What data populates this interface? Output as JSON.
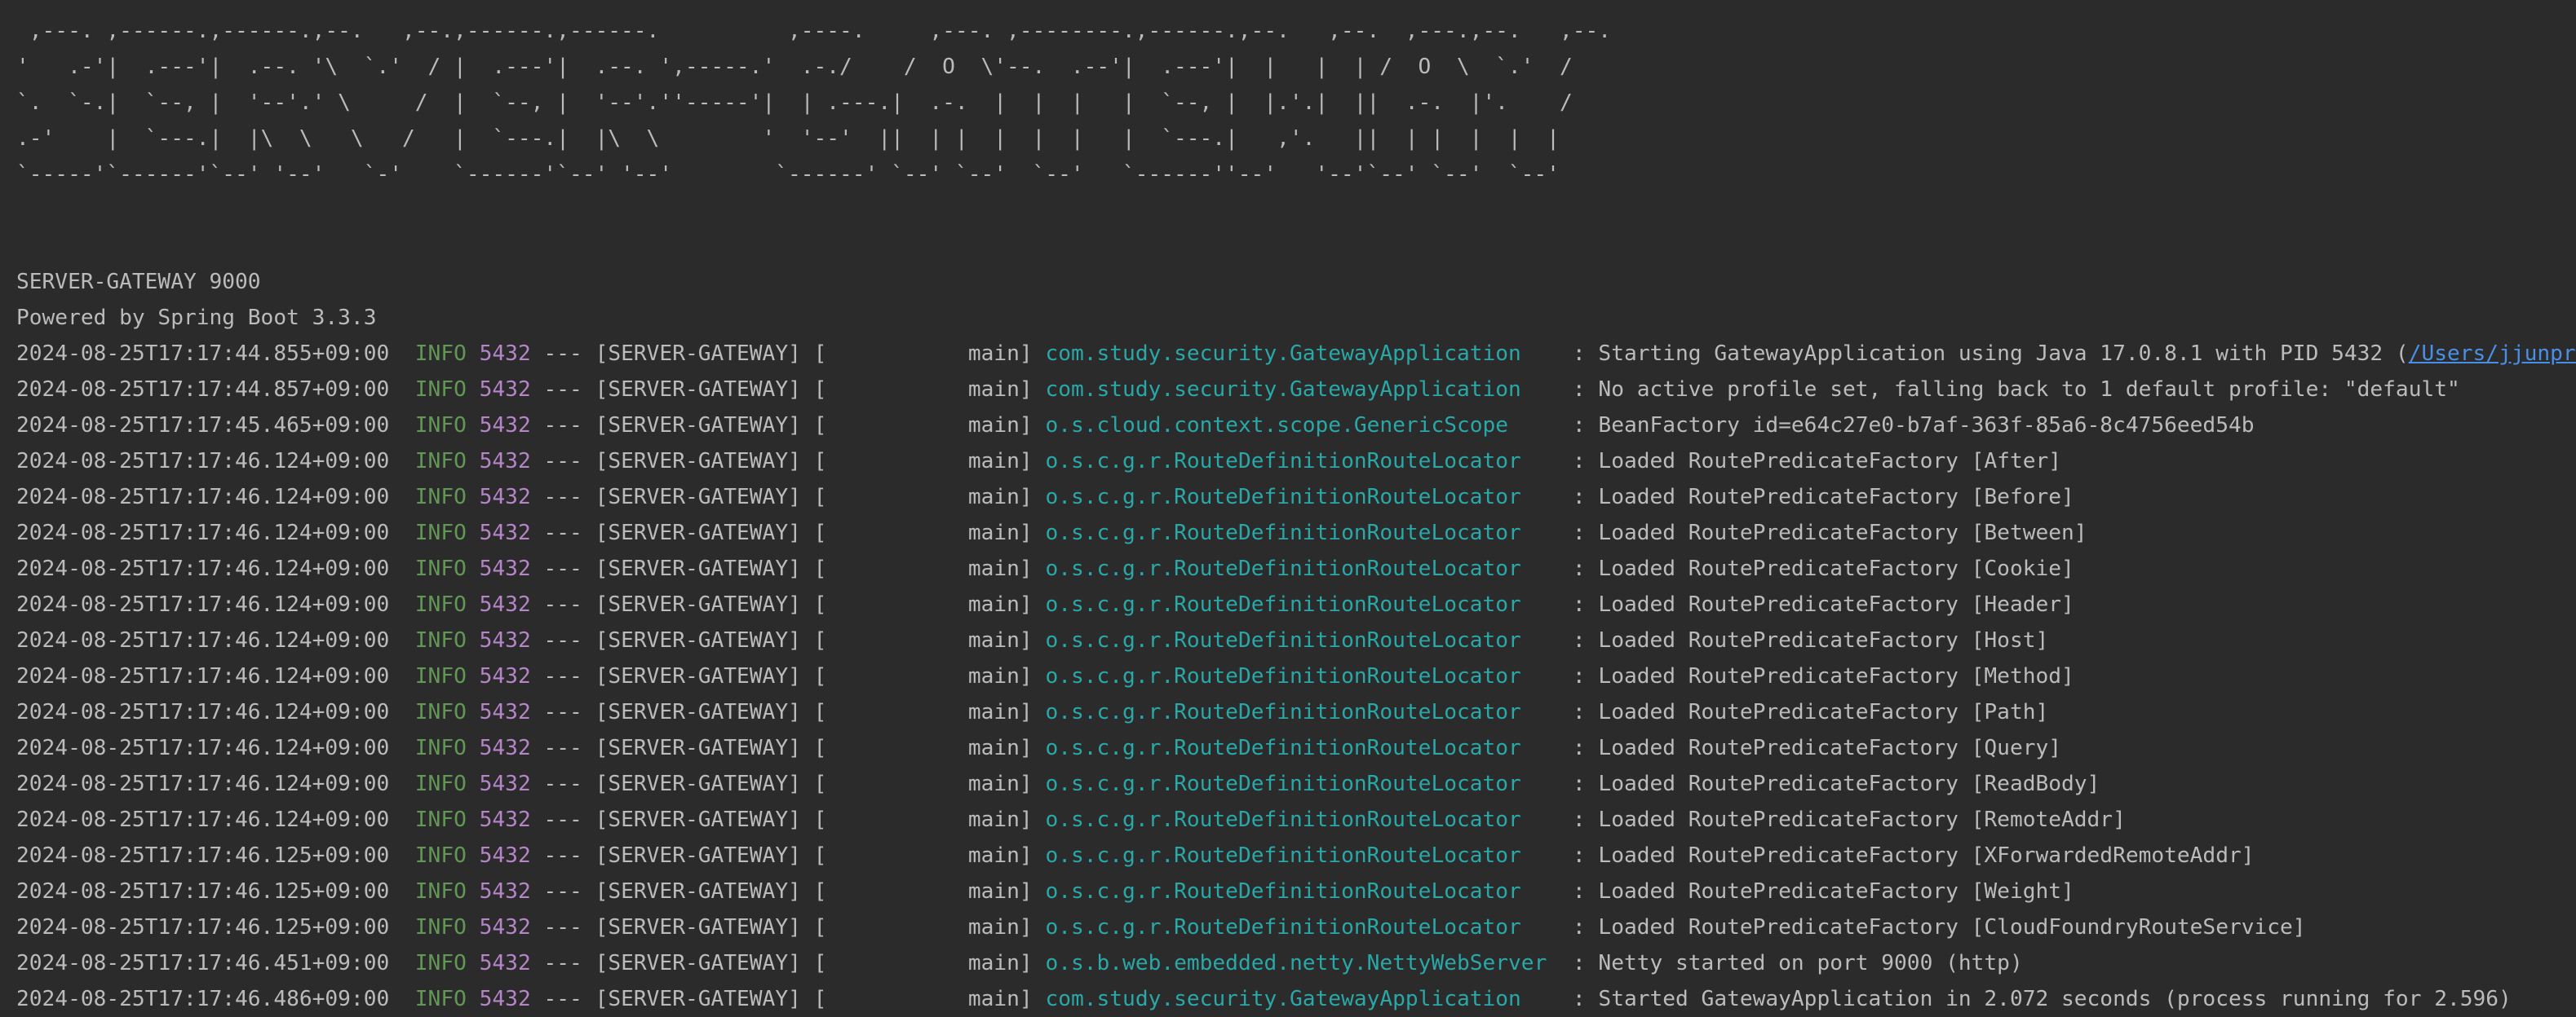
{
  "banner": [
    " ,---. ,------.,------.,--.   ,--.,------.,------.          ,----.     ,---. ,--------.,------.,--.   ,--.  ,---.,--.   ,--.",
    "'   .-'|  .---'|  .--. '\\  `.'  / |  .---'|  .--. ',-----.'  .-./    /  O  \\'--.  .--'|  .---'|  |   |  | /  O  \\  `.'  /",
    "`.  `-.|  `--, |  '--'.' \\     /  |  `--, |  '--'.''-----'|  | .---.|  .-.  |  |  |   |  `--, |  |.'.|  ||  .-.  |'.    /",
    ".-'    |  `---.|  |\\  \\   \\   /   |  `---.|  |\\  \\        '  '--'  ||  | |  |  |  |   |  `---.|   ,'.   ||  | |  |  |  |",
    "`-----'`------'`--' '--'   `-'    `------'`--' '--'        `------' `--' `--'  `--'   `------''--'   '--'`--' `--'  `--'"
  ],
  "header": {
    "app_line": "SERVER-GATEWAY 9000",
    "powered_by": "Powered by Spring Boot 3.3.3"
  },
  "colors": {
    "background": "#2b2b2b",
    "text": "#bbbbbb",
    "info": "#629755",
    "pid": "#b585c8",
    "logger": "#2aa7a7",
    "link": "#4a8fe7"
  },
  "logs": [
    {
      "ts": "2024-08-25T17:17:44.855+09:00",
      "level": "INFO",
      "pid": "5432",
      "sep": "---",
      "app": "[SERVER-GATEWAY]",
      "thread": "[           main]",
      "logger": "com.study.security.GatewayApplication   ",
      "msg": ": Starting GatewayApplication using Java 17.0.8.1 with PID 5432 (",
      "link": "/Users/jjunpro/"
    },
    {
      "ts": "2024-08-25T17:17:44.857+09:00",
      "level": "INFO",
      "pid": "5432",
      "sep": "---",
      "app": "[SERVER-GATEWAY]",
      "thread": "[           main]",
      "logger": "com.study.security.GatewayApplication   ",
      "msg": ": No active profile set, falling back to 1 default profile: \"default\""
    },
    {
      "ts": "2024-08-25T17:17:45.465+09:00",
      "level": "INFO",
      "pid": "5432",
      "sep": "---",
      "app": "[SERVER-GATEWAY]",
      "thread": "[           main]",
      "logger": "o.s.cloud.context.scope.GenericScope    ",
      "msg": ": BeanFactory id=e64c27e0-b7af-363f-85a6-8c4756eed54b"
    },
    {
      "ts": "2024-08-25T17:17:46.124+09:00",
      "level": "INFO",
      "pid": "5432",
      "sep": "---",
      "app": "[SERVER-GATEWAY]",
      "thread": "[           main]",
      "logger": "o.s.c.g.r.RouteDefinitionRouteLocator   ",
      "msg": ": Loaded RoutePredicateFactory [After]"
    },
    {
      "ts": "2024-08-25T17:17:46.124+09:00",
      "level": "INFO",
      "pid": "5432",
      "sep": "---",
      "app": "[SERVER-GATEWAY]",
      "thread": "[           main]",
      "logger": "o.s.c.g.r.RouteDefinitionRouteLocator   ",
      "msg": ": Loaded RoutePredicateFactory [Before]"
    },
    {
      "ts": "2024-08-25T17:17:46.124+09:00",
      "level": "INFO",
      "pid": "5432",
      "sep": "---",
      "app": "[SERVER-GATEWAY]",
      "thread": "[           main]",
      "logger": "o.s.c.g.r.RouteDefinitionRouteLocator   ",
      "msg": ": Loaded RoutePredicateFactory [Between]"
    },
    {
      "ts": "2024-08-25T17:17:46.124+09:00",
      "level": "INFO",
      "pid": "5432",
      "sep": "---",
      "app": "[SERVER-GATEWAY]",
      "thread": "[           main]",
      "logger": "o.s.c.g.r.RouteDefinitionRouteLocator   ",
      "msg": ": Loaded RoutePredicateFactory [Cookie]"
    },
    {
      "ts": "2024-08-25T17:17:46.124+09:00",
      "level": "INFO",
      "pid": "5432",
      "sep": "---",
      "app": "[SERVER-GATEWAY]",
      "thread": "[           main]",
      "logger": "o.s.c.g.r.RouteDefinitionRouteLocator   ",
      "msg": ": Loaded RoutePredicateFactory [Header]"
    },
    {
      "ts": "2024-08-25T17:17:46.124+09:00",
      "level": "INFO",
      "pid": "5432",
      "sep": "---",
      "app": "[SERVER-GATEWAY]",
      "thread": "[           main]",
      "logger": "o.s.c.g.r.RouteDefinitionRouteLocator   ",
      "msg": ": Loaded RoutePredicateFactory [Host]"
    },
    {
      "ts": "2024-08-25T17:17:46.124+09:00",
      "level": "INFO",
      "pid": "5432",
      "sep": "---",
      "app": "[SERVER-GATEWAY]",
      "thread": "[           main]",
      "logger": "o.s.c.g.r.RouteDefinitionRouteLocator   ",
      "msg": ": Loaded RoutePredicateFactory [Method]"
    },
    {
      "ts": "2024-08-25T17:17:46.124+09:00",
      "level": "INFO",
      "pid": "5432",
      "sep": "---",
      "app": "[SERVER-GATEWAY]",
      "thread": "[           main]",
      "logger": "o.s.c.g.r.RouteDefinitionRouteLocator   ",
      "msg": ": Loaded RoutePredicateFactory [Path]"
    },
    {
      "ts": "2024-08-25T17:17:46.124+09:00",
      "level": "INFO",
      "pid": "5432",
      "sep": "---",
      "app": "[SERVER-GATEWAY]",
      "thread": "[           main]",
      "logger": "o.s.c.g.r.RouteDefinitionRouteLocator   ",
      "msg": ": Loaded RoutePredicateFactory [Query]"
    },
    {
      "ts": "2024-08-25T17:17:46.124+09:00",
      "level": "INFO",
      "pid": "5432",
      "sep": "---",
      "app": "[SERVER-GATEWAY]",
      "thread": "[           main]",
      "logger": "o.s.c.g.r.RouteDefinitionRouteLocator   ",
      "msg": ": Loaded RoutePredicateFactory [ReadBody]"
    },
    {
      "ts": "2024-08-25T17:17:46.124+09:00",
      "level": "INFO",
      "pid": "5432",
      "sep": "---",
      "app": "[SERVER-GATEWAY]",
      "thread": "[           main]",
      "logger": "o.s.c.g.r.RouteDefinitionRouteLocator   ",
      "msg": ": Loaded RoutePredicateFactory [RemoteAddr]"
    },
    {
      "ts": "2024-08-25T17:17:46.125+09:00",
      "level": "INFO",
      "pid": "5432",
      "sep": "---",
      "app": "[SERVER-GATEWAY]",
      "thread": "[           main]",
      "logger": "o.s.c.g.r.RouteDefinitionRouteLocator   ",
      "msg": ": Loaded RoutePredicateFactory [XForwardedRemoteAddr]"
    },
    {
      "ts": "2024-08-25T17:17:46.125+09:00",
      "level": "INFO",
      "pid": "5432",
      "sep": "---",
      "app": "[SERVER-GATEWAY]",
      "thread": "[           main]",
      "logger": "o.s.c.g.r.RouteDefinitionRouteLocator   ",
      "msg": ": Loaded RoutePredicateFactory [Weight]"
    },
    {
      "ts": "2024-08-25T17:17:46.125+09:00",
      "level": "INFO",
      "pid": "5432",
      "sep": "---",
      "app": "[SERVER-GATEWAY]",
      "thread": "[           main]",
      "logger": "o.s.c.g.r.RouteDefinitionRouteLocator   ",
      "msg": ": Loaded RoutePredicateFactory [CloudFoundryRouteService]"
    },
    {
      "ts": "2024-08-25T17:17:46.451+09:00",
      "level": "INFO",
      "pid": "5432",
      "sep": "---",
      "app": "[SERVER-GATEWAY]",
      "thread": "[           main]",
      "logger": "o.s.b.web.embedded.netty.NettyWebServer ",
      "msg": ": Netty started on port 9000 (http)"
    },
    {
      "ts": "2024-08-25T17:17:46.486+09:00",
      "level": "INFO",
      "pid": "5432",
      "sep": "---",
      "app": "[SERVER-GATEWAY]",
      "thread": "[           main]",
      "logger": "com.study.security.GatewayApplication   ",
      "msg": ": Started GatewayApplication in 2.072 seconds (process running for 2.596)"
    }
  ]
}
